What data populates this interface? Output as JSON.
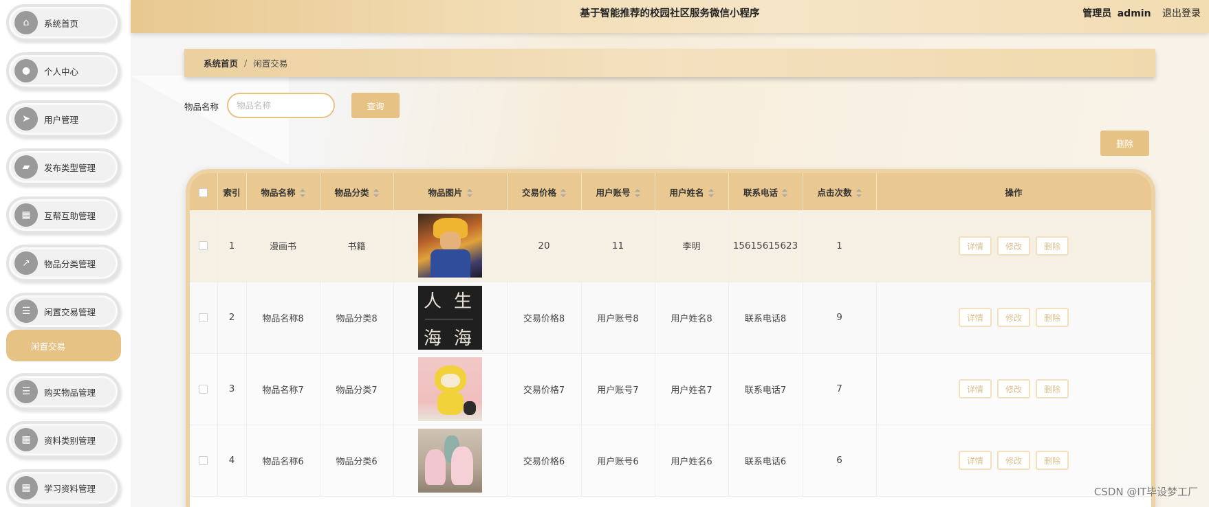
{
  "header": {
    "app_title": "基于智能推荐的校园社区服务微信小程序",
    "role_label": "管理员",
    "username": "admin",
    "logout_label": "退出登录"
  },
  "sidebar": {
    "items": [
      {
        "label": "系统首页",
        "icon": "home-icon"
      },
      {
        "label": "个人中心",
        "icon": "user-icon"
      },
      {
        "label": "用户管理",
        "icon": "send-icon"
      },
      {
        "label": "发布类型管理",
        "icon": "briefcase-icon"
      },
      {
        "label": "互帮互助管理",
        "icon": "grid-icon"
      },
      {
        "label": "物品分类管理",
        "icon": "chart-icon"
      },
      {
        "label": "闲置交易管理",
        "icon": "list-icon"
      },
      {
        "label": "购买物品管理",
        "icon": "list-icon"
      },
      {
        "label": "资料类别管理",
        "icon": "grid-icon"
      },
      {
        "label": "学习资料管理",
        "icon": "grid-icon"
      }
    ],
    "active_sub_item": "闲置交易"
  },
  "breadcrumb": {
    "home": "系统首页",
    "separator": "/",
    "current": "闲置交易"
  },
  "search": {
    "label": "物品名称",
    "placeholder": "物品名称",
    "value": "",
    "query_button": "查询"
  },
  "toolbar": {
    "delete_button": "删除"
  },
  "table": {
    "columns": [
      "",
      "索引",
      "物品名称",
      "物品分类",
      "物品图片",
      "交易价格",
      "用户账号",
      "用户姓名",
      "联系电话",
      "点击次数",
      "操作"
    ],
    "rows": [
      {
        "index": "1",
        "name": "漫画书",
        "category": "书籍",
        "image": "comic-book-image",
        "price": "20",
        "account": "11",
        "username": "李明",
        "phone": "15615615623",
        "clicks": "1"
      },
      {
        "index": "2",
        "name": "物品名称8",
        "category": "物品分类8",
        "image": "book-cover-image",
        "price": "交易价格8",
        "account": "用户账号8",
        "username": "用户姓名8",
        "phone": "联系电话8",
        "clicks": "9"
      },
      {
        "index": "3",
        "name": "物品名称7",
        "category": "物品分类7",
        "image": "plush-toy-image",
        "price": "交易价格7",
        "account": "用户账号7",
        "username": "用户姓名7",
        "phone": "联系电话7",
        "clicks": "7"
      },
      {
        "index": "4",
        "name": "物品名称6",
        "category": "物品分类6",
        "image": "alpaca-toy-image",
        "price": "交易价格6",
        "account": "用户账号6",
        "username": "用户姓名6",
        "phone": "联系电话6",
        "clicks": "6"
      }
    ],
    "row_actions": {
      "detail": "详情",
      "edit": "修改",
      "delete": "删除"
    },
    "book_cover_text": [
      "人",
      "生",
      "海",
      "海"
    ]
  },
  "watermark": "CSDN @IT毕设梦工厂",
  "colors": {
    "accent": "#e6c384",
    "header_bg": "#f2ddb5",
    "table_header": "#e9c991",
    "action_border": "#f2dfbc"
  }
}
